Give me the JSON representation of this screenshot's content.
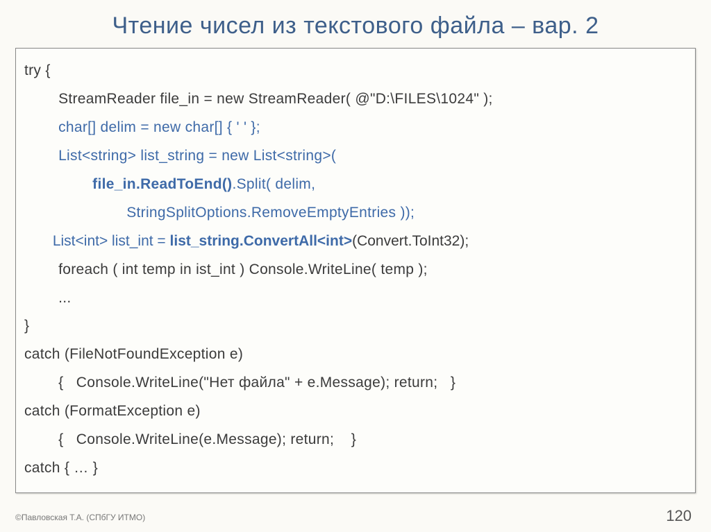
{
  "title": "Чтение чисел из текстового файла – вар. 2",
  "code": {
    "l1": "try {",
    "l2_pre": "        StreamReader file_in = new StreamReader( @\"D:\\FILES\\1024\" );",
    "l3": "        char[] delim = new char[] { ' ' };",
    "l4": "        List<string> list_string = new List<string>(",
    "l5_indent": "                ",
    "l5_bold": "file_in.ReadToEnd()",
    "l5_rest": ".Split( delim,",
    "l6": "                        StringSplitOptions.RemoveEmptyEntries ));",
    "l7a": "       List<int> list_int = ",
    "l7b": "list_string.ConvertAll<int>",
    "l7c": "(Convert.ToInt32);",
    "l8": "        foreach ( int temp in ist_int ) Console.WriteLine( temp );",
    "l9": "        ...",
    "l10": "}",
    "l11": "catch (FileNotFoundException e)",
    "l12": "        {   Console.WriteLine(\"Нет файла\" + e.Message); return;   }",
    "l13": "catch (FormatException e)",
    "l14": "        {   Console.WriteLine(e.Message); return;    }",
    "l15": "catch { … }"
  },
  "footer": {
    "copyright": "©Павловская Т.А. (СПбГУ ИТМО)",
    "page": "120"
  }
}
